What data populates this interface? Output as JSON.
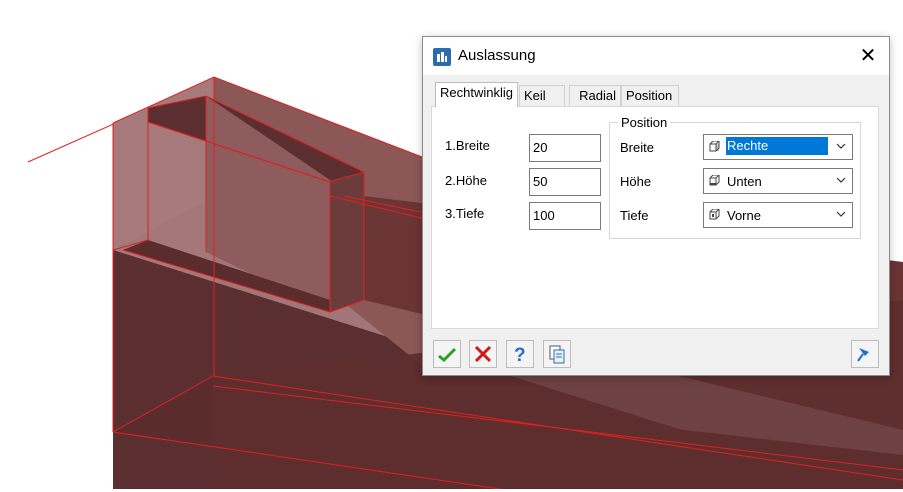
{
  "dialog": {
    "title": "Auslassung",
    "close_symbol": "✕",
    "tabs": [
      {
        "label": "Rechtwinklig",
        "active": true
      },
      {
        "label": "Keil",
        "active": false
      },
      {
        "label": "Radial",
        "active": false
      },
      {
        "label": "Position",
        "active": false
      }
    ],
    "dimensions": [
      {
        "label": "1.Breite",
        "value": "20"
      },
      {
        "label": "2.Höhe",
        "value": "50"
      },
      {
        "label": "3.Tiefe",
        "value": "100"
      }
    ],
    "position_group": {
      "title": "Position",
      "rows": [
        {
          "label": "Breite",
          "value": "Rechte",
          "selected": true
        },
        {
          "label": "Höhe",
          "value": "Unten",
          "selected": false
        },
        {
          "label": "Tiefe",
          "value": "Vorne",
          "selected": false
        }
      ]
    },
    "buttons": [
      {
        "name": "ok-button",
        "icon": "checkmark-icon"
      },
      {
        "name": "cancel-button",
        "icon": "x-icon"
      },
      {
        "name": "help-button",
        "icon": "question-icon"
      },
      {
        "name": "copy-button",
        "icon": "copy-document-icon"
      },
      {
        "name": "pin-button",
        "icon": "pin-icon"
      }
    ]
  },
  "viewport": {
    "object_color": "#6b3a3a",
    "edge_color": "#e02020"
  }
}
